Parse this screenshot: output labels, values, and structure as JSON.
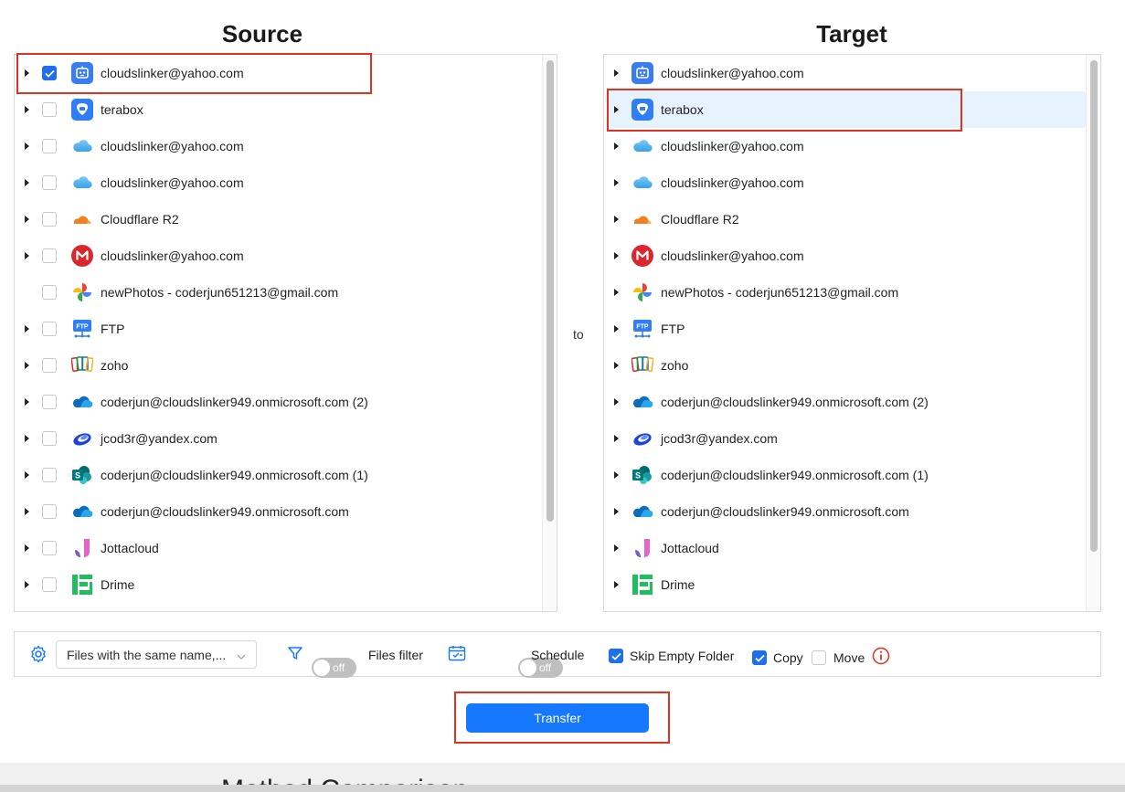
{
  "source": {
    "title": "Source",
    "items": [
      {
        "label": "cloudslinker@yahoo.com",
        "icon": "bot-icon",
        "checked": true,
        "expandable": true
      },
      {
        "label": "terabox",
        "icon": "terabox-icon",
        "checked": false,
        "expandable": true
      },
      {
        "label": "cloudslinker@yahoo.com",
        "icon": "icloud-icon",
        "checked": false,
        "expandable": true
      },
      {
        "label": "cloudslinker@yahoo.com",
        "icon": "icloud-icon",
        "checked": false,
        "expandable": true
      },
      {
        "label": "Cloudflare R2",
        "icon": "cloudflare-icon",
        "checked": false,
        "expandable": true
      },
      {
        "label": "cloudslinker@yahoo.com",
        "icon": "mega-icon",
        "checked": false,
        "expandable": true
      },
      {
        "label": "newPhotos - coderjun651213@gmail.com",
        "icon": "google-photos-icon",
        "checked": false,
        "expandable": false
      },
      {
        "label": "FTP",
        "icon": "ftp-icon",
        "checked": false,
        "expandable": true
      },
      {
        "label": "zoho",
        "icon": "zoho-icon",
        "checked": false,
        "expandable": true
      },
      {
        "label": "coderjun@cloudslinker949.onmicrosoft.com (2)",
        "icon": "onedrive-icon",
        "checked": false,
        "expandable": true
      },
      {
        "label": "jcod3r@yandex.com",
        "icon": "yandex-disk-icon",
        "checked": false,
        "expandable": true
      },
      {
        "label": "coderjun@cloudslinker949.onmicrosoft.com (1)",
        "icon": "sharepoint-icon",
        "checked": false,
        "expandable": true
      },
      {
        "label": "coderjun@cloudslinker949.onmicrosoft.com",
        "icon": "onedrive-icon",
        "checked": false,
        "expandable": true
      },
      {
        "label": "Jottacloud",
        "icon": "jottacloud-icon",
        "checked": false,
        "expandable": true
      },
      {
        "label": "Drime",
        "icon": "drime-icon",
        "checked": false,
        "expandable": true
      }
    ]
  },
  "target": {
    "title": "Target",
    "selected_index": 1,
    "items": [
      {
        "label": "cloudslinker@yahoo.com",
        "icon": "bot-icon"
      },
      {
        "label": "terabox",
        "icon": "terabox-icon"
      },
      {
        "label": "cloudslinker@yahoo.com",
        "icon": "icloud-icon"
      },
      {
        "label": "cloudslinker@yahoo.com",
        "icon": "icloud-icon"
      },
      {
        "label": "Cloudflare R2",
        "icon": "cloudflare-icon"
      },
      {
        "label": "cloudslinker@yahoo.com",
        "icon": "mega-icon"
      },
      {
        "label": "newPhotos - coderjun651213@gmail.com",
        "icon": "google-photos-icon"
      },
      {
        "label": "FTP",
        "icon": "ftp-icon"
      },
      {
        "label": "zoho",
        "icon": "zoho-icon"
      },
      {
        "label": "coderjun@cloudslinker949.onmicrosoft.com (2)",
        "icon": "onedrive-icon"
      },
      {
        "label": "jcod3r@yandex.com",
        "icon": "yandex-disk-icon"
      },
      {
        "label": "coderjun@cloudslinker949.onmicrosoft.com (1)",
        "icon": "sharepoint-icon"
      },
      {
        "label": "coderjun@cloudslinker949.onmicrosoft.com",
        "icon": "onedrive-icon"
      },
      {
        "label": "Jottacloud",
        "icon": "jottacloud-icon"
      },
      {
        "label": "Drime",
        "icon": "drime-icon"
      }
    ]
  },
  "connector": {
    "label": "to"
  },
  "options": {
    "settings_icon": "gear-icon",
    "conflict_select": {
      "value": "Files with the same name,..."
    },
    "files_filter": {
      "toggle_label": "off",
      "label": "Files filter",
      "icon": "filter-icon",
      "on": false
    },
    "schedule": {
      "toggle_label": "off",
      "label": "Schedule",
      "icon": "calendar-icon",
      "on": false
    },
    "skip_empty_folder": {
      "label": "Skip Empty Folder",
      "checked": true
    },
    "copy": {
      "label": "Copy",
      "checked": true
    },
    "move": {
      "label": "Move",
      "checked": false
    },
    "info_icon": "info-icon"
  },
  "actions": {
    "transfer_label": "Transfer"
  },
  "background_page": {
    "partial_heading": "Method Comparison"
  },
  "colors": {
    "accent": "#1677ff",
    "checkbox": "#1f6feb",
    "highlight": "#e0321e",
    "selected_row": "#e6f3ff"
  }
}
